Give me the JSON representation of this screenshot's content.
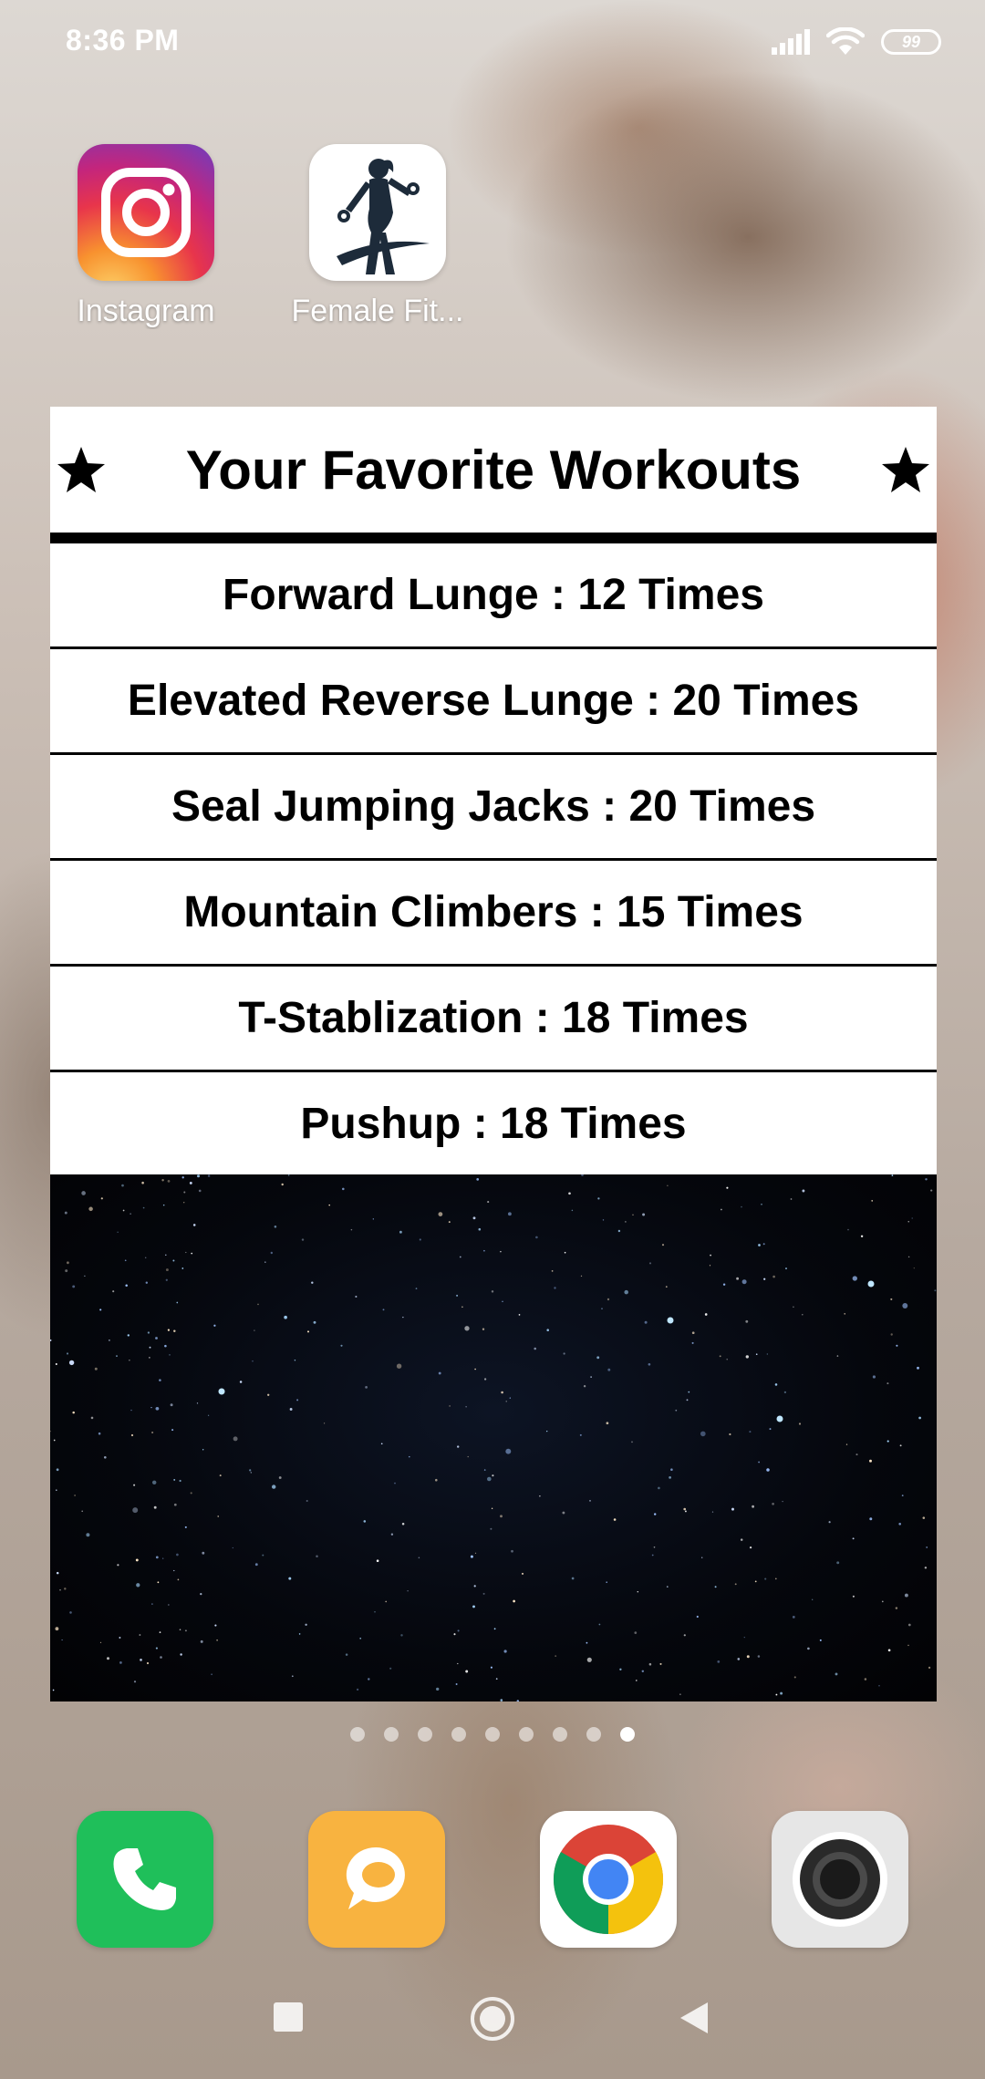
{
  "status_bar": {
    "time": "8:36 PM",
    "battery": "99",
    "icons": [
      "signal-icon",
      "wifi-icon",
      "battery-icon"
    ]
  },
  "home_apps": [
    {
      "label": "Instagram",
      "icon": "instagram-icon"
    },
    {
      "label": "Female Fit...",
      "icon": "female-fitness-icon"
    }
  ],
  "widget": {
    "title": "Your Favorite Workouts",
    "workouts": [
      {
        "text": "Forward Lunge : 12 Times"
      },
      {
        "text": "Elevated Reverse Lunge : 20 Times"
      },
      {
        "text": "Seal Jumping Jacks : 20 Times"
      },
      {
        "text": "Mountain Climbers : 15 Times"
      },
      {
        "text": "T-Stablization : 18 Times"
      },
      {
        "text": "Pushup : 18 Times"
      }
    ]
  },
  "page_indicator": {
    "total": 9,
    "active_index": 8
  },
  "dock": [
    {
      "icon": "phone-icon",
      "color": "#1fbf5a"
    },
    {
      "icon": "messages-icon",
      "color": "#f8b340"
    },
    {
      "icon": "chrome-icon",
      "color": "#ffffff"
    },
    {
      "icon": "camera-icon",
      "color": "#e6e6e6"
    }
  ],
  "nav": [
    "recents-button",
    "home-button",
    "back-button"
  ]
}
